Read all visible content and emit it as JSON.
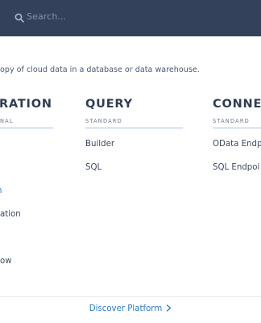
{
  "search": {
    "placeholder": "Search..."
  },
  "intro_text": "opy of cloud data in a database or data warehouse.",
  "columns": [
    {
      "title": "RATION",
      "subtitle": "NAL",
      "items": [
        {
          "label": "n",
          "highlight": true
        },
        {
          "label": "ation",
          "highlight": false
        },
        {
          "label": "ow",
          "highlight": false
        }
      ]
    },
    {
      "title": "QUERY",
      "subtitle": "STANDARD",
      "items": [
        {
          "label": "Builder"
        },
        {
          "label": "SQL"
        }
      ]
    },
    {
      "title": "CONNEC",
      "subtitle": "STANDARD",
      "items": [
        {
          "label": "OData Endp"
        },
        {
          "label": "SQL Endpoi"
        }
      ]
    }
  ],
  "footer": {
    "link_label": "Discover Platform"
  },
  "colors": {
    "header_bg": "#33425a",
    "accent": "#2a7bd6",
    "rule": "#a8c3e6"
  },
  "icons": [
    "search-icon",
    "chevron-right-icon"
  ]
}
